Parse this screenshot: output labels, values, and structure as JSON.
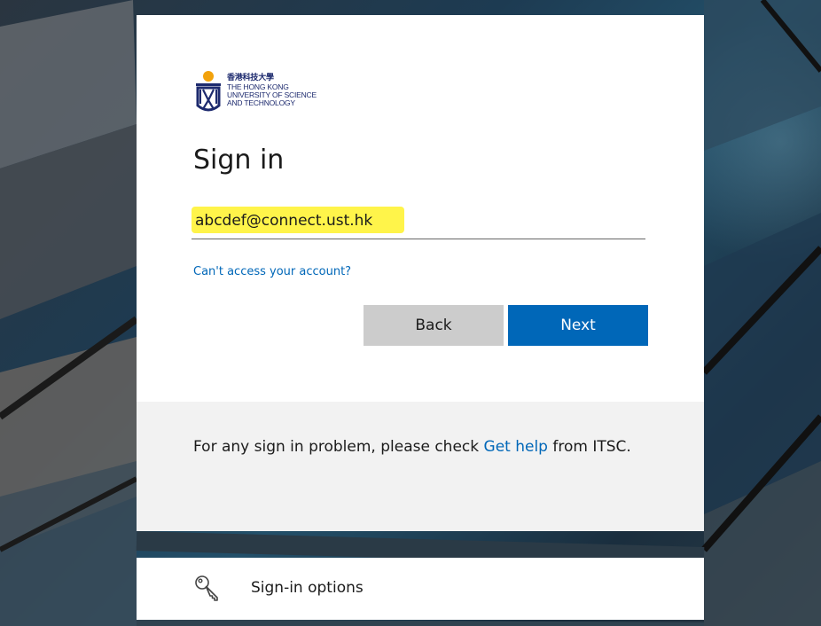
{
  "logo": {
    "name_cjk": "香港科技大學",
    "name_lines": [
      "THE HONG KONG",
      "UNIVERSITY OF SCIENCE",
      "AND TECHNOLOGY"
    ]
  },
  "signin": {
    "title": "Sign in",
    "email_value": "abcdef@connect.ust.hk",
    "cant_access_label": "Can't access your account?",
    "back_label": "Back",
    "next_label": "Next"
  },
  "help": {
    "text_before": "For any sign in problem, please check ",
    "link_label": "Get help",
    "text_after": " from ITSC."
  },
  "options": {
    "label": "Sign-in options",
    "icon": "key-icon"
  },
  "colors": {
    "accent": "#0067b8",
    "highlight": "#fff44a",
    "back_button": "#cccccc"
  }
}
